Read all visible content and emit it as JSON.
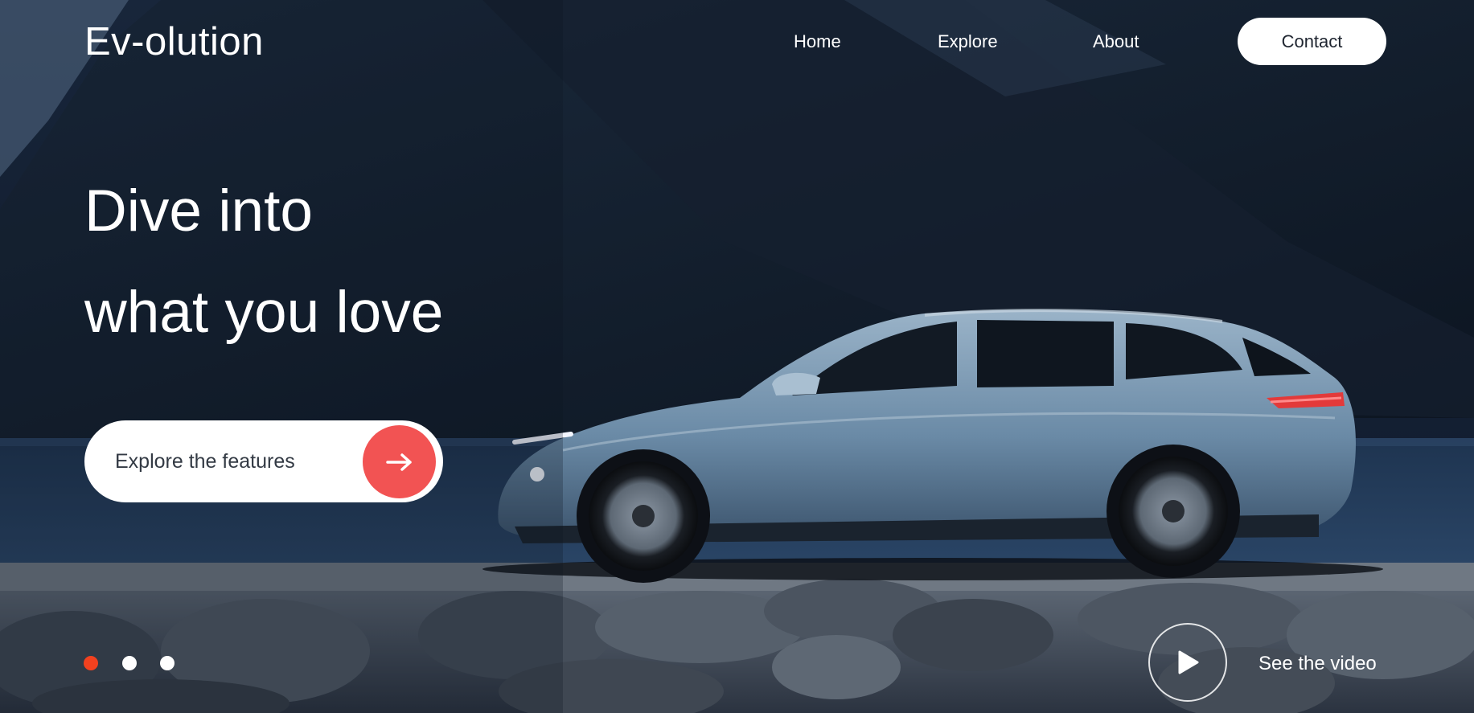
{
  "brand": {
    "logo_text": "Ev-olution"
  },
  "nav": {
    "links": [
      "Home",
      "Explore",
      "About"
    ],
    "contact_label": "Contact"
  },
  "hero": {
    "title_line1": "Dive into",
    "title_line2": "what you love",
    "cta_label": "Explore the features",
    "cta_icon": "arrow-right-icon"
  },
  "slider": {
    "dots": 3,
    "active_index": 0
  },
  "video": {
    "label": "See the video",
    "icon": "play-icon"
  },
  "colors": {
    "accent": "#f25353",
    "active_dot": "#f2411f",
    "text_light": "#ffffff",
    "button_text": "#1f2530"
  }
}
